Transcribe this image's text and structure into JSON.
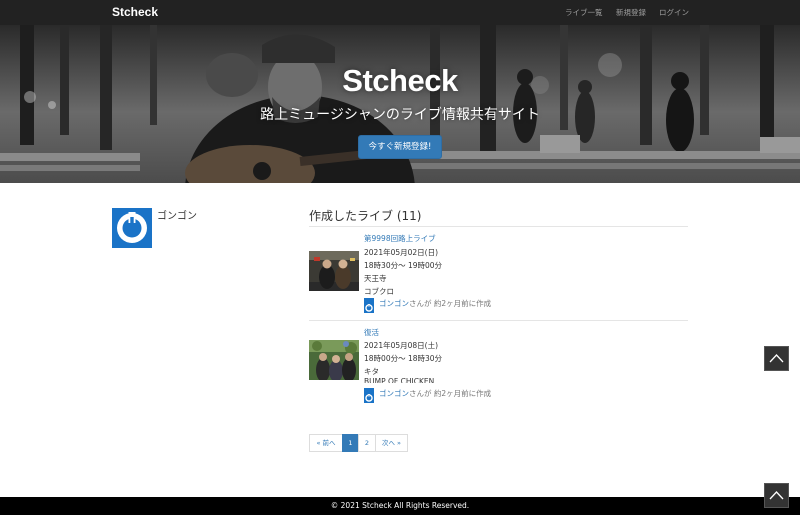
{
  "navbar": {
    "brand": "Stcheck",
    "links": [
      "ライブ一覧",
      "新規登録",
      "ログイン"
    ]
  },
  "hero": {
    "title": "Stcheck",
    "subtitle": "路上ミュージシャンのライブ情報共有サイト",
    "cta_label": "今すぐ新規登録!"
  },
  "profile": {
    "name": "ゴンゴン"
  },
  "lives": {
    "heading": "作成したライブ (11)",
    "items": [
      {
        "title": "第9998回路上ライブ",
        "date": "2021年05月02日(日)",
        "time": "18時30分〜 19時00分",
        "place": "天王寺",
        "artist": "コブクロ",
        "creator": "ゴンゴン",
        "creator_suffix": "さんが 約2ヶ月前に作成"
      },
      {
        "title": "復活",
        "date": "2021年05月08日(土)",
        "time": "18時00分〜 18時30分",
        "place": "キタ",
        "artist": "BUMP OF CHICKEN",
        "creator": "ゴンゴン",
        "creator_suffix": "さんが 約2ヶ月前に作成"
      }
    ]
  },
  "pagination": {
    "prev": "« 前へ",
    "pages": [
      "1",
      "2"
    ],
    "next": "次へ »",
    "current": 1
  },
  "footer": {
    "text": "© 2021 Stcheck All Rights Reserved."
  },
  "colors": {
    "navbar": "#222222",
    "primary": "#337ab7",
    "avatar": "#1a73c7",
    "footer": "#000000"
  },
  "icons": {
    "avatar": "power-icon",
    "scroll_top": "chevron-up-icon"
  }
}
